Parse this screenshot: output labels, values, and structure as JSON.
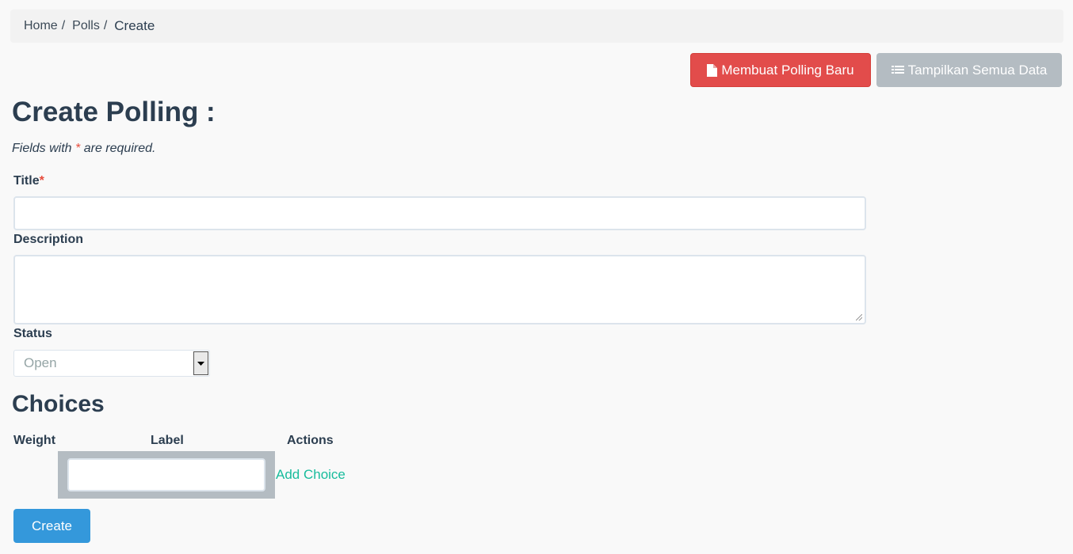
{
  "breadcrumb": {
    "items": [
      {
        "label": "Home"
      },
      {
        "label": "Polls"
      },
      {
        "label": "Create"
      }
    ],
    "separator": "/"
  },
  "toolbar": {
    "new_label": "Membuat Polling Baru",
    "new_icon": "file-icon",
    "list_label": "Tampilkan Semua Data",
    "list_icon": "list-icon",
    "new_color": "#e24c4b",
    "list_color": "#b4bcc2"
  },
  "form": {
    "heading": "Create Polling :",
    "note_prefix": "Fields with",
    "required_marker": "*",
    "note_suffix": "are required.",
    "title_label": "Title",
    "title_value": "",
    "description_label": "Description",
    "description_value": "",
    "status_label": "Status",
    "status_value": "Open"
  },
  "choices": {
    "heading": "Choices",
    "columns": [
      "Weight",
      "Label",
      "Actions"
    ],
    "new_choice_value": "",
    "add_label": "Add Choice"
  },
  "submit": {
    "label": "Create",
    "color": "#3498db"
  }
}
